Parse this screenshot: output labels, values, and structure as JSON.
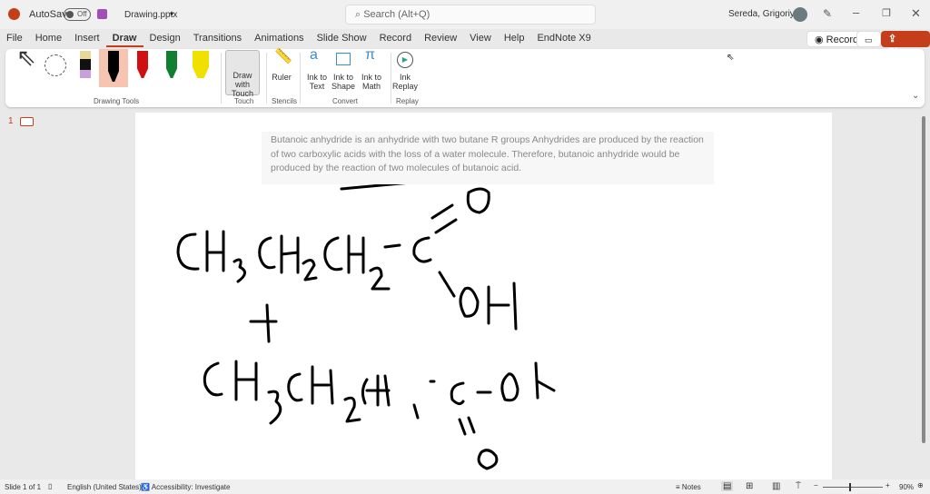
{
  "titlebar": {
    "autosave_label": "AutoSave",
    "autosave_state": "Off",
    "filename": "Drawing.pptx",
    "search_placeholder": "Search (Alt+Q)",
    "user": "Sereda, Grigoriy A"
  },
  "tabs": [
    "File",
    "Home",
    "Insert",
    "Draw",
    "Design",
    "Transitions",
    "Animations",
    "Slide Show",
    "Record",
    "Review",
    "View",
    "Help",
    "EndNote X9"
  ],
  "active_tab": "Draw",
  "actions": {
    "record": "Record",
    "share": "Share"
  },
  "ribbon": {
    "groups": {
      "drawing_tools": "Drawing Tools",
      "touch": "Touch",
      "stencils": "Stencils",
      "convert": "Convert",
      "replay": "Replay"
    },
    "draw_with_touch": "Draw with Touch",
    "ruler": "Ruler",
    "ink_to_text": "Ink to Text",
    "ink_to_shape": "Ink to Shape",
    "ink_to_math": "Ink to Math",
    "ink_replay": "Ink Replay",
    "pen_colors": [
      "#000000",
      "#d01010",
      "#108030",
      "#f0e000"
    ],
    "accent": "#c43e1c"
  },
  "thumbnail": {
    "number": "1"
  },
  "slide": {
    "text": "Butanoic anhydride is an anhydride with two butane R groups Anhydrides are produced by the reaction of two carboxylic acids with the loss of a water molecule. Therefore, butanoic anhydride would be produced by the reaction of two molecules of butanoic acid."
  },
  "status": {
    "slide": "Slide 1 of 1",
    "language": "English (United States)",
    "accessibility": "Accessibility: Investigate",
    "notes": "Notes",
    "zoom": "90%"
  }
}
